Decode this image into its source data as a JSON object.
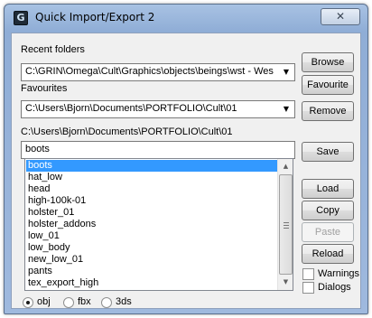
{
  "window": {
    "title": "Quick Import/Export 2",
    "app_icon_glyph": "G",
    "close_glyph": "✕"
  },
  "recent_folders": {
    "label": "Recent folders",
    "value": "C:\\GRIN\\Omega\\Cult\\Graphics\\objects\\beings\\wst - Wes"
  },
  "favourites": {
    "label": "Favourites",
    "value": "C:\\Users\\Bjorn\\Documents\\PORTFOLIO\\Cult\\01"
  },
  "current_path": "C:\\Users\\Bjorn\\Documents\\PORTFOLIO\\Cult\\01",
  "filename_input": {
    "value": "boots"
  },
  "buttons": {
    "browse": "Browse",
    "favourite": "Favourite",
    "remove": "Remove",
    "save": "Save",
    "load": "Load",
    "copy": "Copy",
    "paste": "Paste",
    "reload": "Reload"
  },
  "file_list": {
    "selected_index": 0,
    "items": [
      "boots",
      "hat_low",
      "head",
      "high-100k-01",
      "holster_01",
      "holster_addons",
      "low_01",
      "low_body",
      "new_low_01",
      "pants",
      "tex_export_high"
    ]
  },
  "options": {
    "warnings": {
      "label": "Warnings",
      "checked": false
    },
    "dialogs": {
      "label": "Dialogs",
      "checked": false
    }
  },
  "format": {
    "selected": "obj",
    "choices": [
      "obj",
      "fbx",
      "3ds"
    ]
  },
  "colors": {
    "selection": "#3399ff",
    "titlebar": "#9fb9de"
  }
}
